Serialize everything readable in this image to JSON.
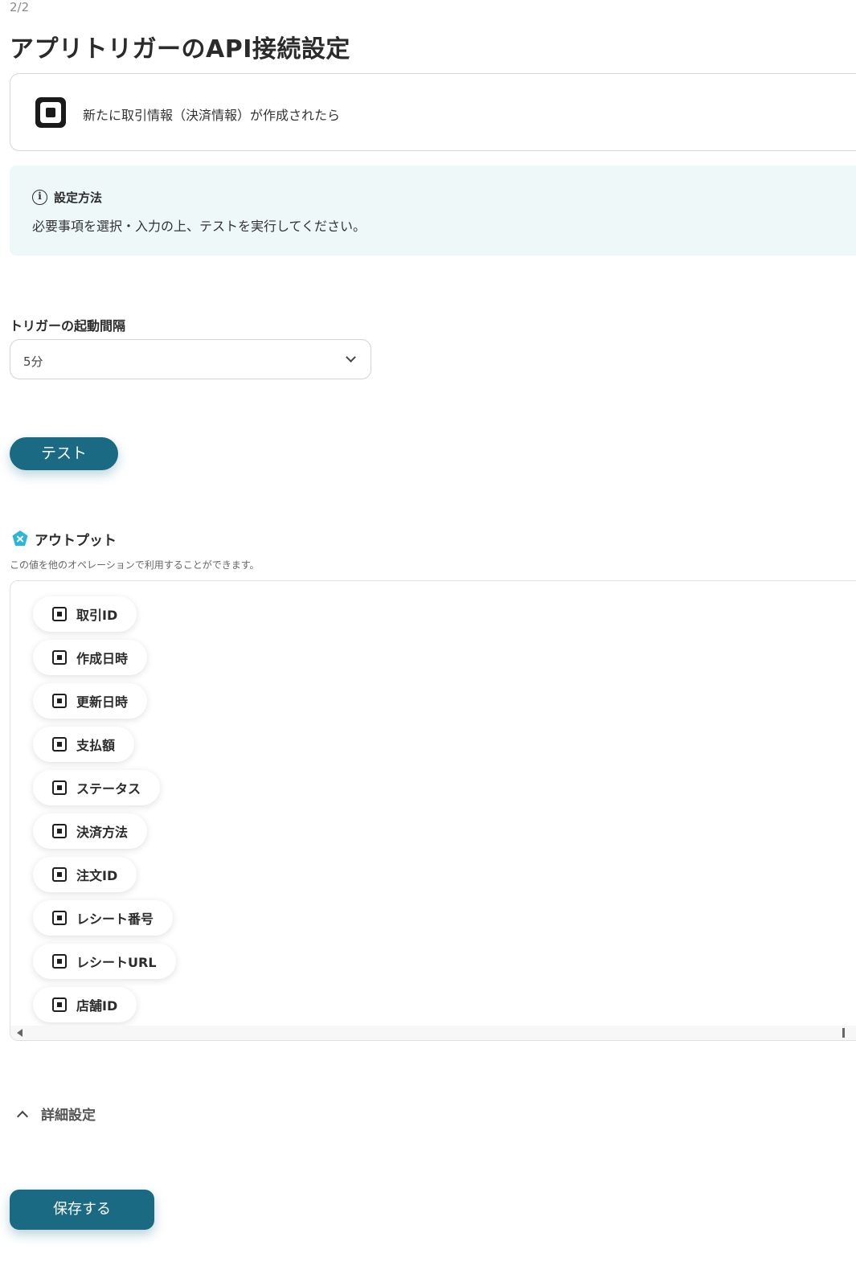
{
  "step": "2/2",
  "page_title": "アプリトリガーのAPI接続設定",
  "trigger_card": {
    "app_icon": "square-logo-icon",
    "description": "新たに取引情報（決済情報）が作成されたら"
  },
  "info": {
    "icon": "info-circle-icon",
    "title": "設定方法",
    "text": "必要事項を選択・入力の上、テストを実行してください。"
  },
  "interval_field": {
    "label": "トリガーの起動間隔",
    "value": "5分",
    "icon": "chevron-down-icon"
  },
  "test_button": "テスト",
  "output": {
    "icon": "output-badge-icon",
    "title": "アウトプット",
    "subtitle": "この値を他のオペレーションで利用することができます。",
    "items": [
      "取引ID",
      "作成日時",
      "更新日時",
      "支払額",
      "ステータス",
      "決済方法",
      "注文ID",
      "レシート番号",
      "レシートURL",
      "店舗ID"
    ]
  },
  "advanced": {
    "icon": "chevron-up-icon",
    "label": "詳細設定"
  },
  "save_button": "保存する",
  "colors": {
    "primary": "#1a6a83",
    "info_bg": "#eef8f8",
    "output_badge": "#29b6d8"
  }
}
